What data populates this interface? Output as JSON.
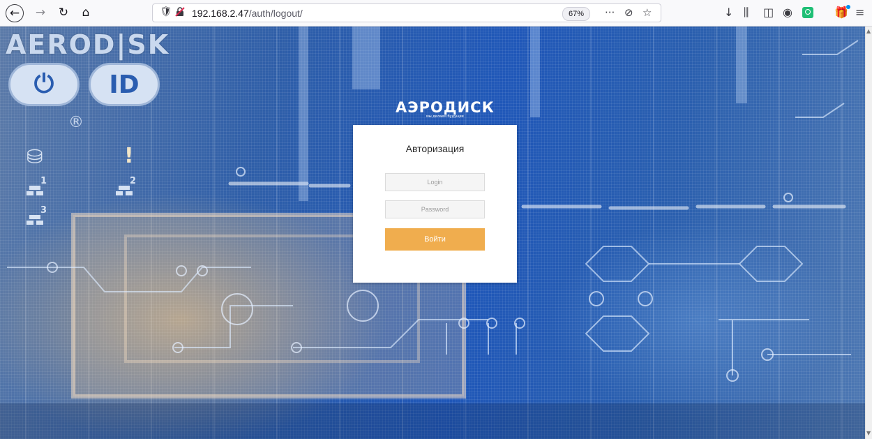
{
  "browser": {
    "url_host": "192.168.2.47",
    "url_path": "/auth/logout/",
    "zoom": "67%",
    "back_glyph": "←",
    "forward_glyph": "→",
    "reload_glyph": "↻",
    "home_glyph": "⌂",
    "shield_glyph": "🛡",
    "more_glyph": "···",
    "pocket_glyph": "⊘",
    "star_glyph": "☆",
    "download_glyph": "↓",
    "library_glyph": "⫼",
    "sidebar_glyph": "◫",
    "account_glyph": "◉",
    "gift_glyph": "🎁",
    "menu_glyph": "≡"
  },
  "background": {
    "brand": "AEROD|SK",
    "power_glyph": "⏻",
    "id_label": "ID",
    "registered": "®",
    "disk_glyph": "⛁",
    "warning_glyph": "!",
    "net1": "1",
    "net2": "2",
    "net3": "3"
  },
  "login": {
    "logo": "АЭРОДИСК",
    "tagline": "мы делаем будущее",
    "title": "Авторизация",
    "login_placeholder": "Login",
    "password_placeholder": "Password",
    "submit_label": "Войти",
    "accent": "#f0ad4e"
  }
}
